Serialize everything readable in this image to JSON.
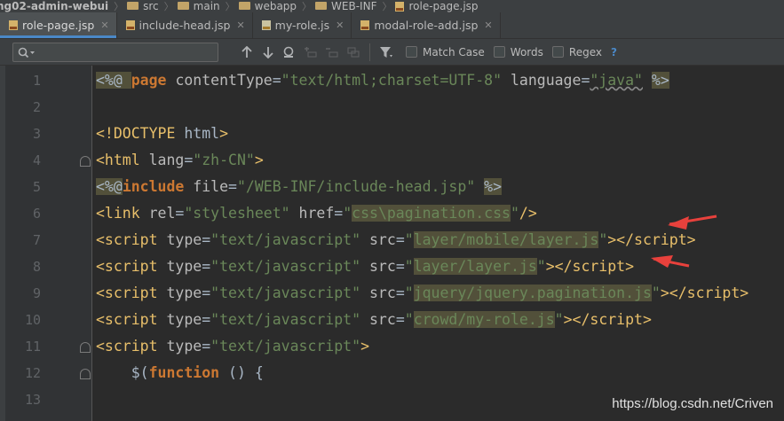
{
  "breadcrumb": {
    "items": [
      "ng02-admin-webui",
      "src",
      "main",
      "webapp",
      "WEB-INF",
      "role-page.jsp"
    ]
  },
  "tabs": [
    {
      "label": "role-page.jsp",
      "active": true
    },
    {
      "label": "include-head.jsp",
      "active": false
    },
    {
      "label": "my-role.js",
      "active": false
    },
    {
      "label": "modal-role-add.jsp",
      "active": false
    }
  ],
  "find": {
    "placeholder": "",
    "value": "",
    "options": {
      "match_case": "Match Case",
      "words": "Words",
      "regex": "Regex",
      "help": "?"
    }
  },
  "editor": {
    "line_numbers": [
      "1",
      "2",
      "3",
      "4",
      "5",
      "6",
      "7",
      "8",
      "9",
      "10",
      "11",
      "12",
      "13"
    ]
  },
  "watermark": "https://blog.csdn.net/Criven",
  "colors": {
    "accent": "#4a88c7",
    "arrow": "#e8413c",
    "highlight": "#52503a"
  }
}
